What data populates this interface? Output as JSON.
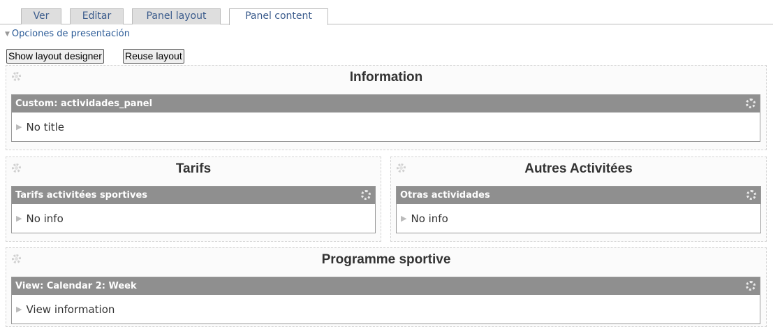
{
  "tabs": [
    {
      "label": "Ver"
    },
    {
      "label": "Editar"
    },
    {
      "label": "Panel layout"
    },
    {
      "label": "Panel content",
      "active": true
    }
  ],
  "options_link": "Opciones de presentación",
  "buttons": {
    "show_layout_designer": "Show layout designer",
    "reuse_layout": "Reuse layout"
  },
  "regions": {
    "information": {
      "title": "Information",
      "pane_title": "Custom: actividades_panel",
      "pane_body": "No title"
    },
    "tarifs": {
      "title": "Tarifs",
      "pane_title": "Tarifs activitées sportives",
      "pane_body": "No info"
    },
    "autres": {
      "title": "Autres Activitées",
      "pane_title": "Otras actividades",
      "pane_body": "No info"
    },
    "programme": {
      "title": "Programme sportive",
      "pane_title": "View: Calendar 2: Week",
      "pane_body": "View information"
    }
  },
  "icons": {
    "region_gear": "gear-icon",
    "pane_gear": "gear-icon",
    "expand": "triangle-right-icon",
    "collapse": "triangle-down-icon"
  },
  "colors": {
    "pane_header": "#8f8f8f",
    "link": "#2a5a96",
    "tab_bg": "#dedede"
  }
}
